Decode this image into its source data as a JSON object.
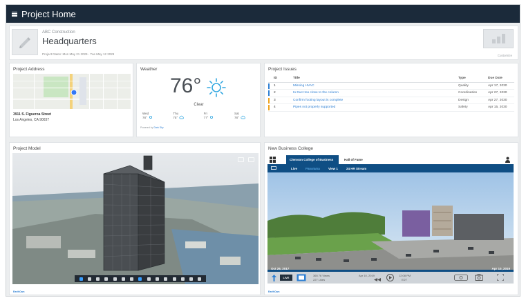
{
  "app": {
    "title": "Project Home"
  },
  "project": {
    "company": "ABC Construction",
    "name": "Headquarters",
    "dates": "Project Dates: Mon May 21 2029 - Tue May 12 2029",
    "customize_label": "Customize"
  },
  "address": {
    "title": "Project Address",
    "line1": "3911 S. Figueroa Street",
    "line2": "Los Angeles, CA 90037",
    "map_footer": "Map data ©2018 Google  Terms of Use  Report a map error"
  },
  "weather": {
    "title": "Weather",
    "temperature": "76°",
    "condition": "Clear",
    "forecast": [
      {
        "day": "Wed",
        "temp": "78°"
      },
      {
        "day": "Thu",
        "temp": "75°"
      },
      {
        "day": "Fri",
        "temp": "77°"
      },
      {
        "day": "Sat",
        "temp": "78°"
      }
    ],
    "powered_prefix": "Powered by",
    "powered_link": "Dark Sky"
  },
  "issues": {
    "title": "Project Issues",
    "headers": {
      "id": "ID",
      "title": "Title",
      "type": "Type",
      "due": "Due Date"
    },
    "rows": [
      {
        "id": "1",
        "title": "Missing HVAC",
        "type": "Quality",
        "due": "Apr 17, 2030",
        "color": "#2d7fd3"
      },
      {
        "id": "2",
        "title": "to Duct too close to the column",
        "type": "Coordination",
        "due": "Apr 27, 2030",
        "color": "#2d7fd3"
      },
      {
        "id": "3",
        "title": "Confirm footing layout is complete",
        "type": "Design",
        "due": "Apr 27, 2030",
        "color": "#f0a31b"
      },
      {
        "id": "4",
        "title": "Pipes not properly supported",
        "type": "Safety",
        "due": "Apr 15, 2030",
        "color": "#f0a31b"
      }
    ]
  },
  "model": {
    "title": "Project Model",
    "footer": "EarthCam"
  },
  "camera": {
    "title": "New Business College",
    "tabs": [
      "Clemson College of Business",
      "Hall of Fame"
    ],
    "subtabs": [
      "Live",
      "Panorama",
      "View 1",
      "24 HR Stream"
    ],
    "date_left": "Oct 26, 2017",
    "date_right": "Apr 10, 2019",
    "live_label": "LIVE",
    "views_text": "365 76 Views",
    "likes_text": "227 Likes",
    "current_date": "Apr 10, 2019",
    "current_time": "12:08 PM",
    "tz": "EDT",
    "footer": "EarthCam"
  },
  "colors": {
    "navy": "#1b2a3a",
    "blue": "#0f4e84",
    "link": "#2d7fd3",
    "sun": "#36a9e1"
  }
}
